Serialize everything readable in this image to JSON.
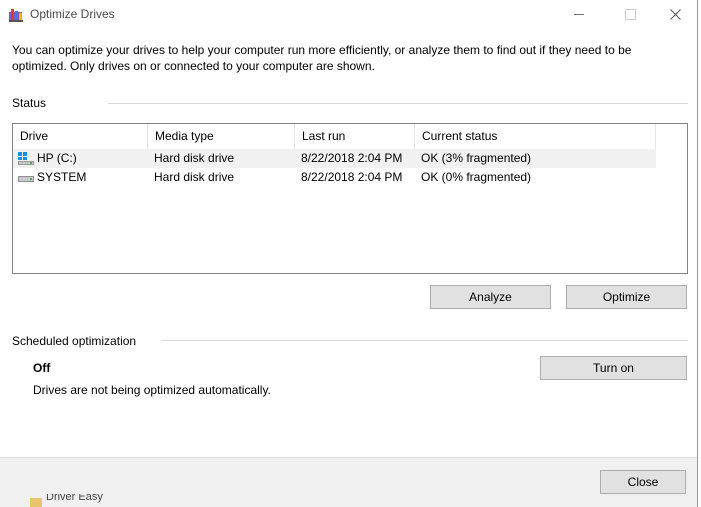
{
  "window": {
    "title": "Optimize Drives",
    "icon": "optimize-drives-app-icon"
  },
  "description": "You can optimize your drives to help your computer run more efficiently, or analyze them to find out if they need to be optimized. Only drives on or connected to your computer are shown.",
  "status": {
    "label": "Status",
    "columns": [
      "Drive",
      "Media type",
      "Last run",
      "Current status"
    ],
    "drives": [
      {
        "icon": "windows-drive-icon",
        "name": "HP (C:)",
        "media_type": "Hard disk drive",
        "last_run": "8/22/2018 2:04 PM",
        "current_status": "OK (3% fragmented)",
        "selected": true
      },
      {
        "icon": "hard-drive-icon",
        "name": "SYSTEM",
        "media_type": "Hard disk drive",
        "last_run": "8/22/2018 2:04 PM",
        "current_status": "OK (0% fragmented)",
        "selected": false
      }
    ],
    "analyze_label": "Analyze",
    "optimize_label": "Optimize"
  },
  "scheduled": {
    "label": "Scheduled optimization",
    "state": "Off",
    "description": "Drives are not being optimized automatically.",
    "turn_on_label": "Turn on"
  },
  "footer": {
    "close_label": "Close"
  },
  "background": {
    "partial_text": "Driver Easy"
  }
}
